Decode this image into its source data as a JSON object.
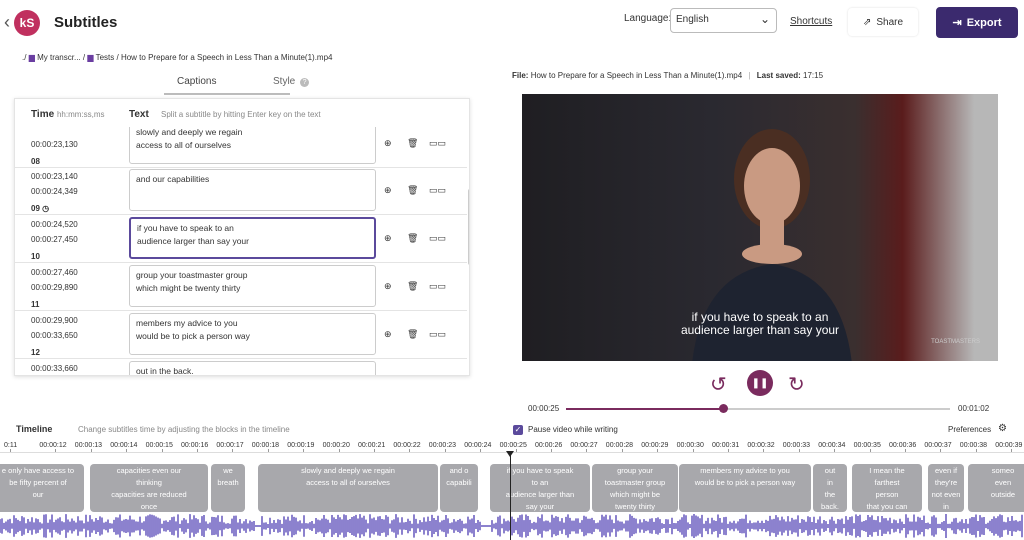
{
  "header": {
    "back_glyph": "‹",
    "logo": "kS",
    "title": "Subtitles",
    "language_label": "Language:",
    "language_value": "English",
    "shortcuts": "Shortcuts",
    "share": "Share",
    "export": "Export"
  },
  "breadcrumb": {
    "root": "./",
    "items": [
      "My transcr...",
      "Tests"
    ],
    "sep": "/",
    "current": "How to Prepare for a Speech in Less Than a Minute(1).mp4"
  },
  "tabs": [
    "Captions",
    "Style"
  ],
  "fileinfo": {
    "file_label": "File:",
    "file_name": "How to Prepare for a Speech in Less Than a Minute(1).mp4",
    "saved_label": "Last saved:",
    "saved_time": "17:15"
  },
  "editor": {
    "time_header": "Time",
    "time_format": "hh:mm:ss,ms",
    "text_header": "Text",
    "text_hint": "Split a subtitle by hitting Enter key on the text",
    "rows": [
      {
        "start": "00:00:23,130",
        "end": "",
        "num": "08",
        "line1": "slowly and deeply we regain",
        "line2": "access to all of ourselves"
      },
      {
        "start": "00:00:23,140",
        "end": "00:00:24,349",
        "num": "09",
        "line1": "and our capabilities",
        "line2": ""
      },
      {
        "start": "00:00:24,520",
        "end": "00:00:27,450",
        "num": "10",
        "line1": "if you have to speak to an",
        "line2": "audience larger than say your"
      },
      {
        "start": "00:00:27,460",
        "end": "00:00:29,890",
        "num": "11",
        "line1": "group your toastmaster group",
        "line2": "which might be twenty thirty"
      },
      {
        "start": "00:00:29,900",
        "end": "00:00:33,650",
        "num": "12",
        "line1": "members my advice to you",
        "line2": "would be to pick a person way"
      },
      {
        "start": "00:00:33,660",
        "end": "",
        "num": "",
        "line1": "out in the back.",
        "line2": ""
      }
    ]
  },
  "video": {
    "subtitle_line1": "if you have to speak to an",
    "subtitle_line2": "audience larger than say your",
    "watermark": "TOASTMASTERS"
  },
  "player": {
    "current": "00:00:25",
    "duration": "00:01:02",
    "progress": 0.41
  },
  "timeline": {
    "title": "Timeline",
    "hint": "Change subtitles time by adjusting the blocks in the timeline",
    "pause_label": "Pause video while writing",
    "preferences": "Preferences",
    "ticks": [
      "0:11",
      "00:00:12",
      "00:00:13",
      "00:00:14",
      "00:00:15",
      "00:00:16",
      "00:00:17",
      "00:00:18",
      "00:00:19",
      "00:00:20",
      "00:00:21",
      "00:00:22",
      "00:00:23",
      "00:00:24",
      "00:00:25",
      "00:00:26",
      "00:00:27",
      "00:00:28",
      "00:00:29",
      "00:00:30",
      "00:00:31",
      "00:00:32",
      "00:00:33",
      "00:00:34",
      "00:00:35",
      "00:00:36",
      "00:00:37",
      "00:00:38",
      "00:00:39"
    ],
    "blocks": [
      {
        "l1": "e only have access to",
        "l2": "be fifty percent of",
        "l3": "our"
      },
      {
        "l1": "capacities even our",
        "l2": "thinking",
        "l3": "capacities are reduced",
        "l4": "once"
      },
      {
        "l1": "we",
        "l2": "breath"
      },
      {
        "l1": "slowly and deeply we regain",
        "l2": "access to all of ourselves"
      },
      {
        "l1": "and o",
        "l2": "capabili"
      },
      {
        "l1": "if you have to speak",
        "l2": "to an",
        "l3": "audience larger than",
        "l4": "say your"
      },
      {
        "l1": "group your",
        "l2": "toastmaster group",
        "l3": "which might be",
        "l4": "twenty thirty"
      },
      {
        "l1": "members my advice to you",
        "l2": "would be to pick a person way"
      },
      {
        "l1": "out",
        "l2": "in",
        "l3": "the",
        "l4": "back."
      },
      {
        "l1": "I mean the",
        "l2": "farthest",
        "l3": "person",
        "l4": "that you can"
      },
      {
        "l1": "even if",
        "l2": "they're",
        "l3": "not even",
        "l4": "in"
      },
      {
        "l1": "someo",
        "l2": "even",
        "l3": "outside"
      }
    ]
  },
  "colors": {
    "accent": "#3b2a6e",
    "player": "#7a2b5e",
    "block": "#a8a8ac",
    "wave": "#6f62c2"
  }
}
